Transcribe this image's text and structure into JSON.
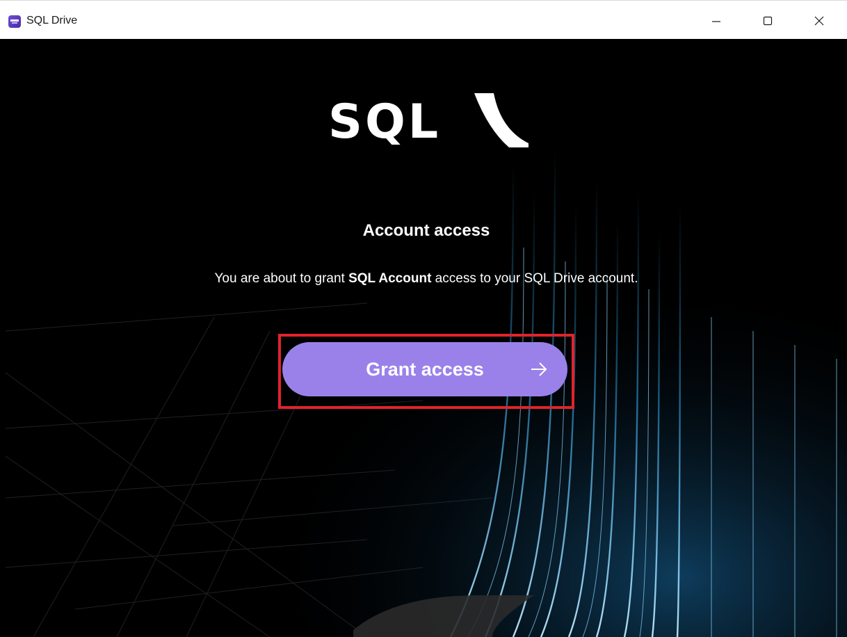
{
  "window": {
    "title": "SQL Drive",
    "controls": [
      "minimize",
      "maximize",
      "close"
    ]
  },
  "main": {
    "logo_text": "SQL",
    "heading": "Account access",
    "description": {
      "prefix": "You are about to grant ",
      "bold": "SQL Account",
      "suffix": " access to your SQL Drive account."
    },
    "grant_button_label": "Grant access"
  },
  "colors": {
    "button_bg": "#9a81ea",
    "highlight": "#e1232c",
    "background": "#000000",
    "light_streaks": "#39b8ff"
  },
  "icons": [
    "app-icon",
    "minimize-icon",
    "maximize-icon",
    "close-icon",
    "arrow-right-icon"
  ]
}
